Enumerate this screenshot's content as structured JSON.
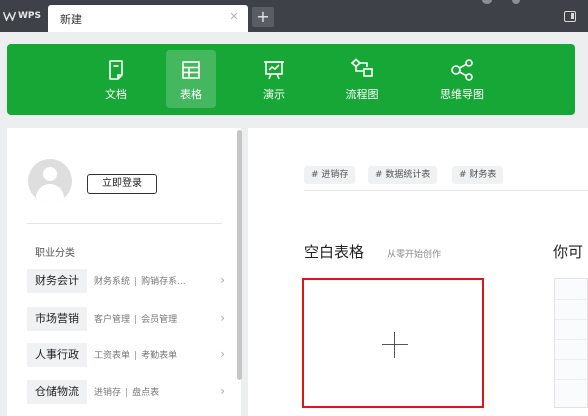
{
  "titlebar": {
    "logo_text": "WPS",
    "tab_label": "新建",
    "tab_close": "✕",
    "new_tab": "+"
  },
  "toolbar": {
    "accent_color": "#17a737",
    "items": [
      {
        "label": "文档",
        "icon": "document-icon",
        "active": false
      },
      {
        "label": "表格",
        "icon": "table-icon",
        "active": true
      },
      {
        "label": "演示",
        "icon": "presentation-icon",
        "active": false
      },
      {
        "label": "流程图",
        "icon": "flowchart-icon",
        "active": false
      },
      {
        "label": "思维导图",
        "icon": "mindmap-icon",
        "active": false
      }
    ]
  },
  "user": {
    "login_label": "立即登录"
  },
  "categories": {
    "title": "职业分类",
    "items": [
      {
        "name": "财务会计",
        "link1": "财务系统",
        "link2": "购销存系..."
      },
      {
        "name": "市场营销",
        "link1": "客户管理",
        "link2": "会员管理"
      },
      {
        "name": "人事行政",
        "link1": "工资表单",
        "link2": "考勤表单"
      },
      {
        "name": "仓储物流",
        "link1": "进销存",
        "link2": "盘点表"
      }
    ],
    "separator": "|",
    "arrow": "›"
  },
  "main": {
    "tags": [
      "# 进销存",
      "# 数据统计表",
      "# 财务表"
    ],
    "blank_title": "空白表格",
    "blank_subtitle": "从零开始创作",
    "right_title": "你可",
    "highlight_color": "#e01616"
  }
}
